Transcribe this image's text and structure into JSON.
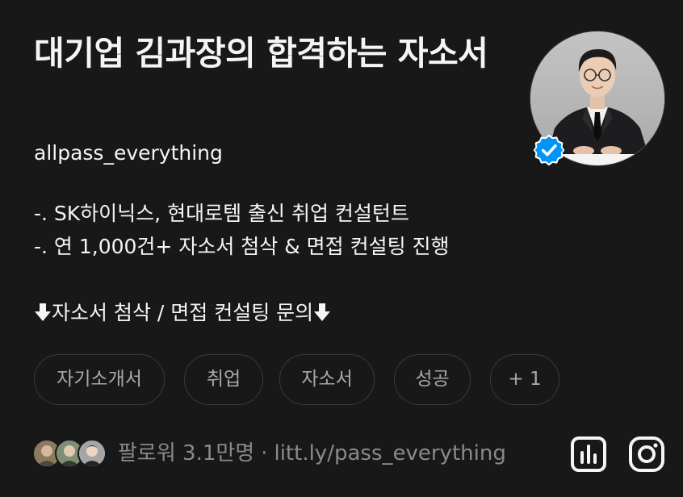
{
  "profile": {
    "title": "대기업 김과장의 합격하는 자소서",
    "username": "allpass_everything",
    "verified": true
  },
  "bio": {
    "line1": "-. SK하이닉스, 현대로템 출신 취업 컨설턴트",
    "line2": "-. 연 1,000건+ 자소서 첨삭 & 면접 컨설팅 진행",
    "cta": "자소서 첨삭 / 면접 컨설팅 문의"
  },
  "tags": [
    "자기소개서",
    "취업",
    "자소서",
    "성공",
    "+ 1"
  ],
  "footer": {
    "followers": "팔로워 3.1만명",
    "separator": "·",
    "link": "litt.ly/pass_everything"
  },
  "icons": {
    "verified": "verified-badge-icon",
    "arrow": "down-arrow-icon",
    "insights": "bar-chart-icon",
    "instagram": "instagram-icon"
  },
  "colors": {
    "background": "#181818",
    "primary_text": "#f3f5f7",
    "secondary_text": "#8a8a8a",
    "tag_text": "#a9a9a9",
    "border": "#3a3a3a",
    "verified": "#0095f6"
  }
}
